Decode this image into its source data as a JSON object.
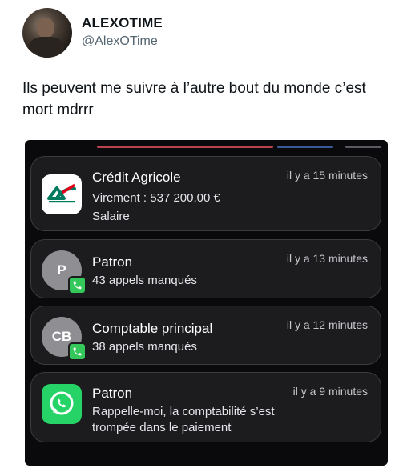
{
  "tweet": {
    "author_name": "ALEXOTIME",
    "author_handle": "@AlexOTime",
    "text": "Ils peuvent me suivre à l’autre bout du monde c’est mort mdrrr"
  },
  "notifications": [
    {
      "app_icon": "credit-agricole-logo",
      "title": "Crédit Agricole",
      "time": "il y a 15 minutes",
      "line1": "Virement : 537 200,00 €",
      "line2": "Salaire"
    },
    {
      "avatar_initials": "P",
      "badge_icon": "phone-icon",
      "title": "Patron",
      "time": "il y a 13 minutes",
      "line1": "43 appels manqués"
    },
    {
      "avatar_initials": "CB",
      "badge_icon": "phone-icon",
      "title": "Comptable principal",
      "time": "il y a 12 minutes",
      "line1": "38 appels manqués"
    },
    {
      "app_icon": "whatsapp-icon",
      "title": "Patron",
      "time": "il y a 9 minutes",
      "line1": "Rappelle-moi, la comptabilité s’est",
      "line2": "trompée dans le paiement"
    }
  ],
  "colors": {
    "notification_bg": "#1c1c1f",
    "whatsapp_green": "#25d366",
    "phone_green": "#34c759",
    "ca_green": "#007a5e",
    "ca_red": "#e2001a"
  }
}
